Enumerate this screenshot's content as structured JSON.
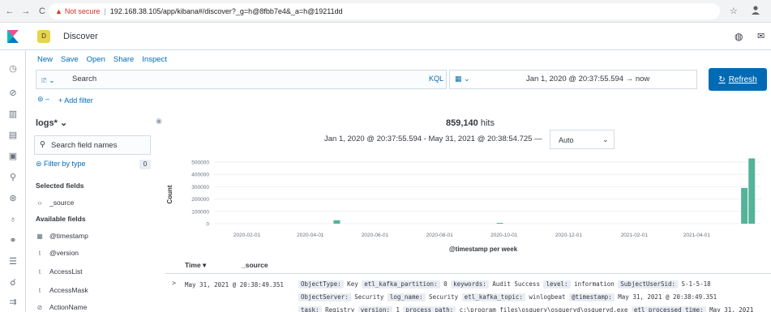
{
  "browser": {
    "back": "←",
    "forward": "→",
    "reload": "C",
    "warning": "▲",
    "not_secure": "Not secure",
    "separator": "|",
    "url": "192.168.38.105/app/kibana#/discover?_g=h@8fbb7e4&_a=h@19211dd"
  },
  "header": {
    "space_initial": "D",
    "title": "Discover"
  },
  "top_menu": [
    "New",
    "Save",
    "Open",
    "Share",
    "Inspect"
  ],
  "query": {
    "placeholder": "Search",
    "language": "KQL"
  },
  "date_picker": {
    "range": "Jan 1, 2020 @ 20:37:55.594  →  now"
  },
  "refresh_label": "Refresh",
  "add_filter": "+ Add filter",
  "sidebar": {
    "index_pattern": "logs*",
    "field_search_placeholder": "Search field names",
    "filter_by_type": "Filter by type",
    "filter_count": "0",
    "selected_title": "Selected fields",
    "selected_fields": [
      {
        "type": "‹›",
        "name": "_source"
      }
    ],
    "available_title": "Available fields",
    "available_fields": [
      {
        "type": "▦",
        "name": "@timestamp"
      },
      {
        "type": "t",
        "name": "@version"
      },
      {
        "type": "t",
        "name": "AccessList"
      },
      {
        "type": "t",
        "name": "AccessMask"
      },
      {
        "type": "⊘",
        "name": "ActionName"
      }
    ]
  },
  "hits": {
    "count": "859,140",
    "label": "hits"
  },
  "histogram": {
    "range": "Jan 1, 2020 @ 20:37:55.594 - May 31, 2021 @ 20:38:54.725 —",
    "interval": "Auto"
  },
  "chart_data": {
    "type": "bar",
    "xlabel": "@timestamp per week",
    "ylabel": "Count",
    "ylim": [
      0,
      500000
    ],
    "ytick_labels": [
      "500000",
      "400000",
      "300000",
      "200000",
      "100000",
      "0"
    ],
    "xtick_labels": [
      "2020-02-01",
      "2020-04-01",
      "2020-06-01",
      "2020-08-01",
      "2020-10-01",
      "2020-12-01",
      "2021-02-01",
      "2021-04-01"
    ],
    "x": [
      "2020-04-26",
      "2020-09-27",
      "2021-05-16",
      "2021-05-23"
    ],
    "values": [
      28000,
      1500,
      290000,
      530000
    ],
    "color": "#54b399"
  },
  "table": {
    "col_time": "Time",
    "col_source": "_source",
    "row_time": "May 31, 2021 @ 20:38:49.351",
    "row_expand": ">",
    "source_lines": [
      [
        [
          "ObjectType:",
          "Key"
        ],
        [
          "etl_kafka_partition:",
          "0"
        ],
        [
          "keywords:",
          "Audit Success"
        ],
        [
          "level:",
          "information"
        ],
        [
          "SubjectUserSid:",
          "S-1-5-18"
        ]
      ],
      [
        [
          "ObjectServer:",
          "Security"
        ],
        [
          "log_name:",
          "Security"
        ],
        [
          "etl_kafka_topic:",
          "winlogbeat"
        ],
        [
          "@timestamp:",
          "May 31, 2021 @ 20:38:49.351"
        ]
      ],
      [
        [
          "task:",
          "Registry"
        ],
        [
          "version:",
          "1"
        ],
        [
          "process_path:",
          "c:\\program files\\osquery\\osqueryd\\osqueryd.exe"
        ],
        [
          "etl_processed_time:",
          "May 31, 2021"
        ]
      ]
    ]
  }
}
